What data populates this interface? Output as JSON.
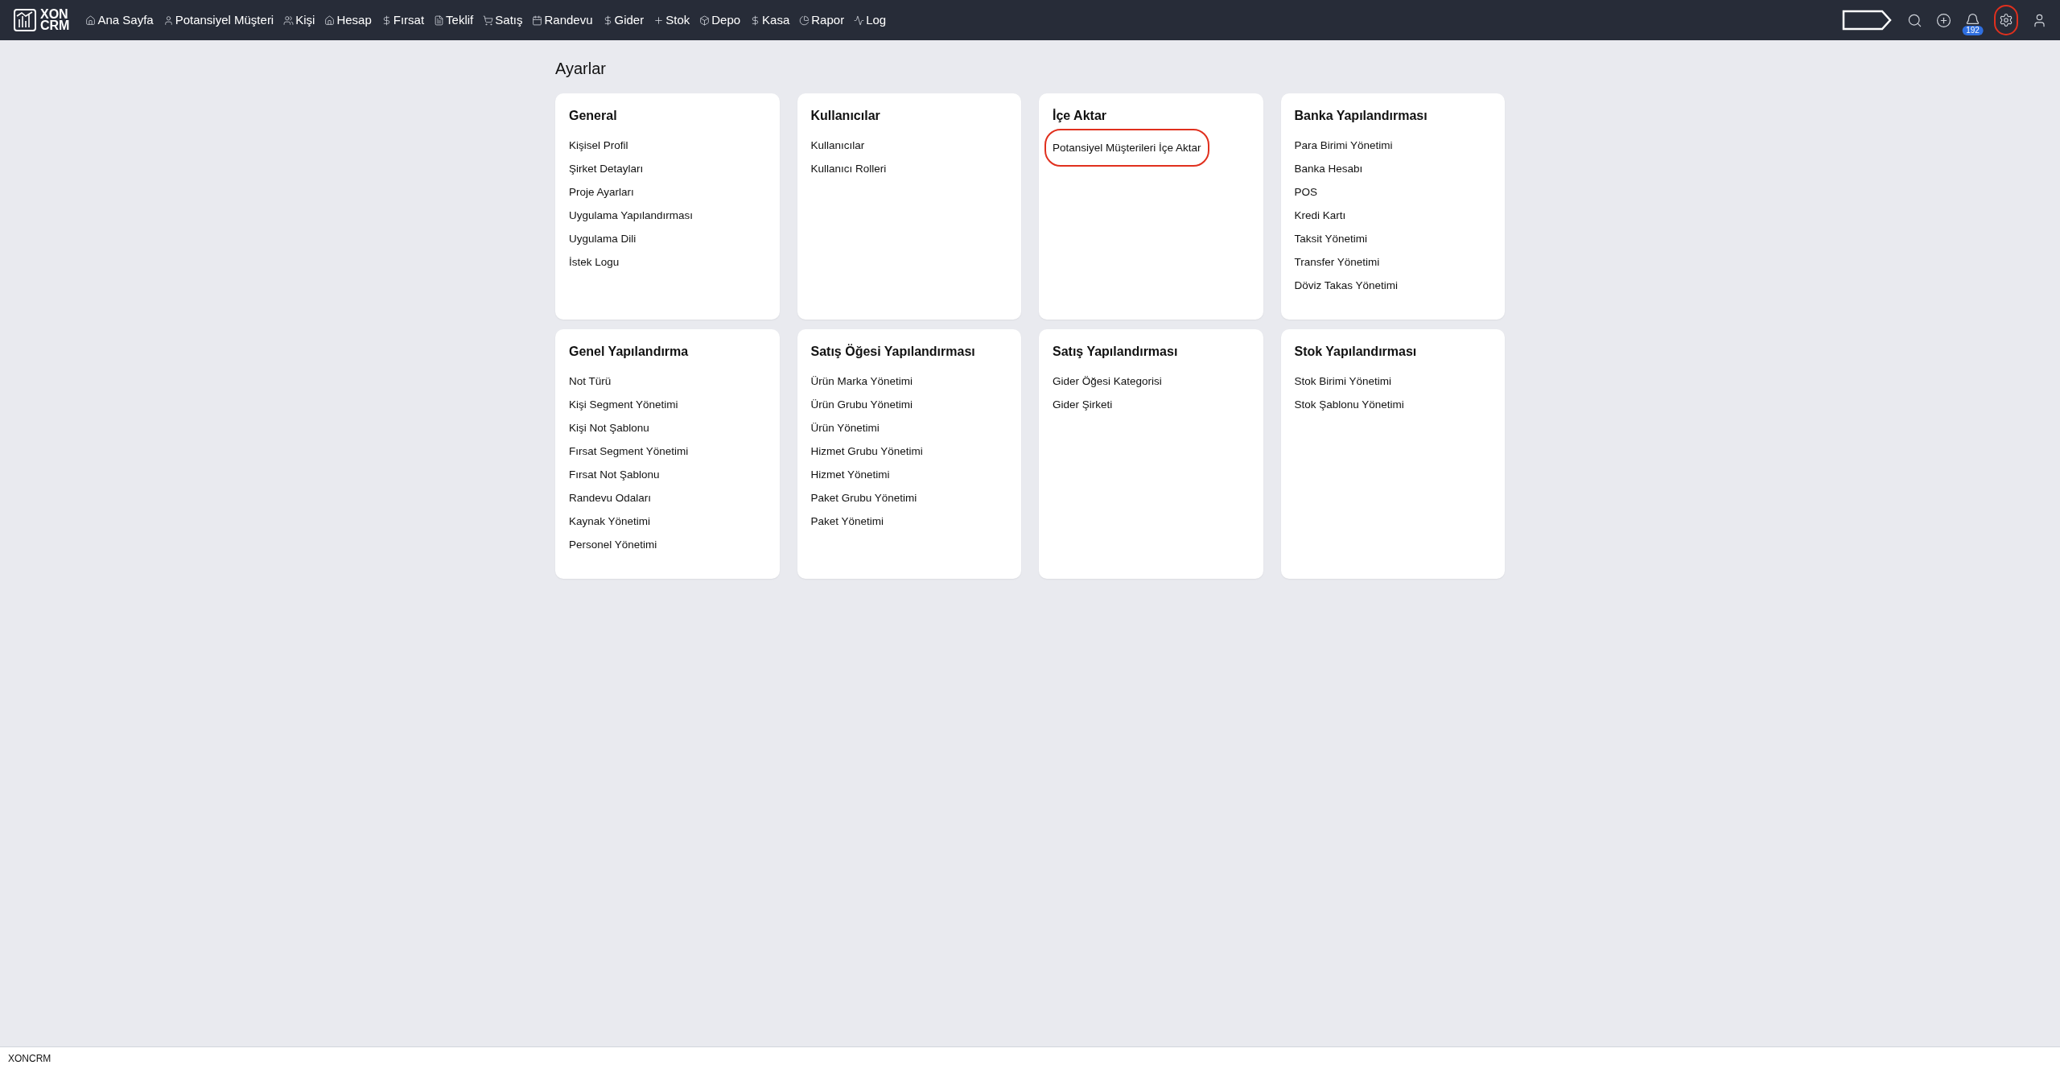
{
  "navbar": {
    "logo": "XON\nCRM",
    "items": [
      {
        "label": "Ana Sayfa"
      },
      {
        "label": "Potansiyel Müşteri"
      },
      {
        "label": "Kişi"
      },
      {
        "label": "Hesap"
      },
      {
        "label": "Fırsat"
      },
      {
        "label": "Teklif"
      },
      {
        "label": "Satış"
      },
      {
        "label": "Randevu"
      },
      {
        "label": "Gider"
      },
      {
        "label": "Stok"
      },
      {
        "label": "Depo"
      },
      {
        "label": "Kasa"
      },
      {
        "label": "Rapor"
      },
      {
        "label": "Log"
      }
    ],
    "notification_count": "192",
    "settings_highlighted": true
  },
  "page": {
    "title": "Ayarlar",
    "cards": [
      {
        "title": "General",
        "items": [
          {
            "label": "Kişisel Profil",
            "highlighted": false
          },
          {
            "label": "Şirket Detayları",
            "highlighted": false
          },
          {
            "label": "Proje Ayarları",
            "highlighted": false
          },
          {
            "label": "Uygulama Yapılandırması",
            "highlighted": false
          },
          {
            "label": "Uygulama Dili",
            "highlighted": false
          },
          {
            "label": "İstek Logu",
            "highlighted": false
          }
        ]
      },
      {
        "title": "Kullanıcılar",
        "items": [
          {
            "label": "Kullanıcılar",
            "highlighted": false
          },
          {
            "label": "Kullanıcı Rolleri",
            "highlighted": false
          }
        ]
      },
      {
        "title": "İçe Aktar",
        "items": [
          {
            "label": "Potansiyel Müşterileri İçe Aktar",
            "highlighted": true
          }
        ]
      },
      {
        "title": "Banka Yapılandırması",
        "items": [
          {
            "label": "Para Birimi Yönetimi",
            "highlighted": false
          },
          {
            "label": "Banka Hesabı",
            "highlighted": false
          },
          {
            "label": "POS",
            "highlighted": false
          },
          {
            "label": "Kredi Kartı",
            "highlighted": false
          },
          {
            "label": "Taksit Yönetimi",
            "highlighted": false
          },
          {
            "label": "Transfer Yönetimi",
            "highlighted": false
          },
          {
            "label": "Döviz Takas Yönetimi",
            "highlighted": false
          }
        ]
      },
      {
        "title": "Genel Yapılandırma",
        "items": [
          {
            "label": "Not Türü",
            "highlighted": false
          },
          {
            "label": "Kişi Segment Yönetimi",
            "highlighted": false
          },
          {
            "label": "Kişi Not Şablonu",
            "highlighted": false
          },
          {
            "label": "Fırsat Segment Yönetimi",
            "highlighted": false
          },
          {
            "label": "Fırsat Not Şablonu",
            "highlighted": false
          },
          {
            "label": "Randevu Odaları",
            "highlighted": false
          },
          {
            "label": "Kaynak Yönetimi",
            "highlighted": false
          },
          {
            "label": "Personel Yönetimi",
            "highlighted": false
          }
        ]
      },
      {
        "title": "Satış Öğesi Yapılandırması",
        "items": [
          {
            "label": "Ürün Marka Yönetimi",
            "highlighted": false
          },
          {
            "label": "Ürün Grubu Yönetimi",
            "highlighted": false
          },
          {
            "label": "Ürün Yönetimi",
            "highlighted": false
          },
          {
            "label": "Hizmet Grubu Yönetimi",
            "highlighted": false
          },
          {
            "label": "Hizmet Yönetimi",
            "highlighted": false
          },
          {
            "label": "Paket Grubu Yönetimi",
            "highlighted": false
          },
          {
            "label": "Paket Yönetimi",
            "highlighted": false
          }
        ]
      },
      {
        "title": "Satış Yapılandırması",
        "items": [
          {
            "label": "Gider Öğesi Kategorisi",
            "highlighted": false
          },
          {
            "label": "Gider Şirketi",
            "highlighted": false
          }
        ]
      },
      {
        "title": "Stok Yapılandırması",
        "items": [
          {
            "label": "Stok Birimi Yönetimi",
            "highlighted": false
          },
          {
            "label": "Stok Şablonu Yönetimi",
            "highlighted": false
          }
        ]
      }
    ]
  },
  "footer": {
    "text": "XONCRM"
  }
}
